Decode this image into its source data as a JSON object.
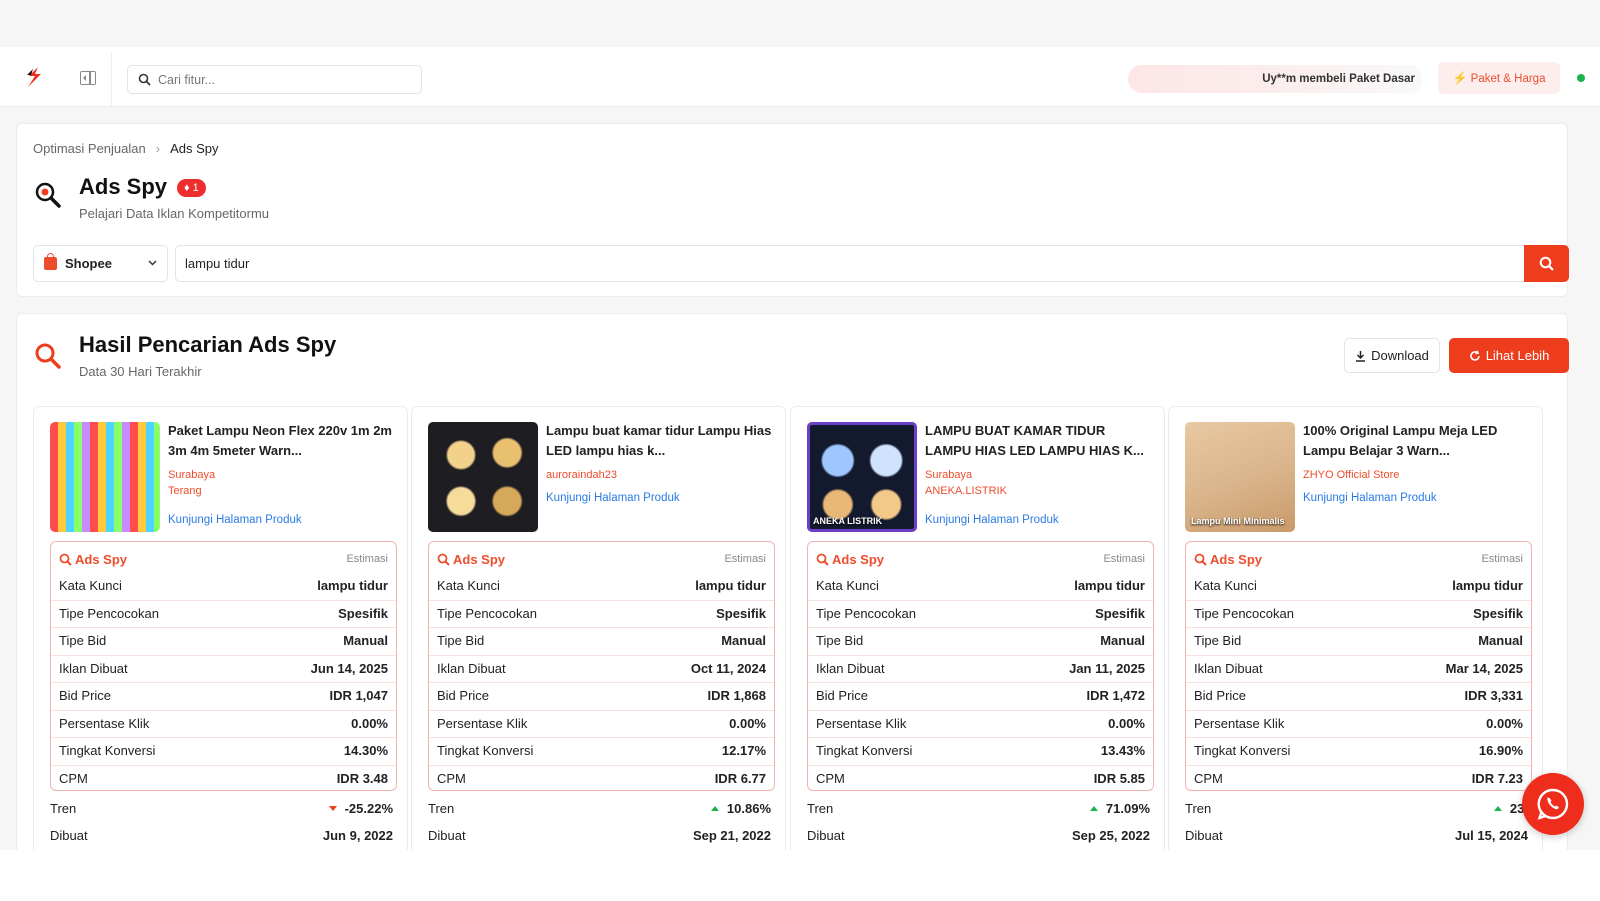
{
  "topbar": {
    "search_placeholder": "Cari fitur...",
    "notification": "Uy**m membeli Paket Dasar",
    "plan_button": "Paket & Harga"
  },
  "breadcrumb": {
    "parent": "Optimasi Penjualan",
    "current": "Ads Spy"
  },
  "page": {
    "title": "Ads Spy",
    "badge": "1",
    "subtitle": "Pelajari Data Iklan Kompetitormu"
  },
  "search": {
    "platform": "Shopee",
    "keyword": "lampu tidur"
  },
  "results": {
    "title": "Hasil Pencarian Ads Spy",
    "subtitle": "Data 30 Hari Terakhir",
    "download_label": "Download",
    "more_label": "Lihat Lebih"
  },
  "labels": {
    "ads_spy": "Ads Spy",
    "estimasi": "Estimasi",
    "visit": "Kunjungi Halaman Produk",
    "kata_kunci": "Kata Kunci",
    "tipe_pencocokan": "Tipe Pencocokan",
    "tipe_bid": "Tipe Bid",
    "iklan_dibuat": "Iklan Dibuat",
    "bid_price": "Bid Price",
    "persentase_klik": "Persentase Klik",
    "tingkat_konversi": "Tingkat Konversi",
    "cpm": "CPM",
    "tren": "Tren",
    "dibuat": "Dibuat"
  },
  "products": [
    {
      "name": "Paket Lampu Neon Flex 220v 1m 2m 3m 4m 5meter Warn...",
      "shop": "Surabaya",
      "shop2": "Terang",
      "keyword": "lampu tidur",
      "match": "Spesifik",
      "bid_type": "Manual",
      "ad_created": "Jun 14, 2025",
      "bid_price": "IDR 1,047",
      "ctr": "0.00%",
      "conversion": "14.30%",
      "cpm": "IDR 3.48",
      "trend": "-25.22%",
      "trend_dir": "down",
      "created": "Jun 9, 2022"
    },
    {
      "name": "Lampu buat kamar tidur Lampu Hias LED lampu hias k...",
      "shop": "auroraindah23",
      "shop2": "",
      "keyword": "lampu tidur",
      "match": "Spesifik",
      "bid_type": "Manual",
      "ad_created": "Oct 11, 2024",
      "bid_price": "IDR 1,868",
      "ctr": "0.00%",
      "conversion": "12.17%",
      "cpm": "IDR 6.77",
      "trend": "10.86%",
      "trend_dir": "up",
      "created": "Sep 21, 2022"
    },
    {
      "name": "LAMPU BUAT KAMAR TIDUR LAMPU HIAS LED LAMPU HIAS K...",
      "shop": "Surabaya",
      "shop2": "ANEKA.LISTRIK",
      "thumb_text": "ANEKA LISTRIK",
      "keyword": "lampu tidur",
      "match": "Spesifik",
      "bid_type": "Manual",
      "ad_created": "Jan 11, 2025",
      "bid_price": "IDR 1,472",
      "ctr": "0.00%",
      "conversion": "13.43%",
      "cpm": "IDR 5.85",
      "trend": "71.09%",
      "trend_dir": "up",
      "created": "Sep 25, 2022"
    },
    {
      "name": "100% Original Lampu Meja LED Lampu Belajar 3 Warn...",
      "shop": "ZHYO Official Store",
      "shop2": "",
      "thumb_text": "Lampu Mini Minimalis",
      "keyword": "lampu tidur",
      "match": "Spesifik",
      "bid_type": "Manual",
      "ad_created": "Mar 14, 2025",
      "bid_price": "IDR 3,331",
      "ctr": "0.00%",
      "conversion": "16.90%",
      "cpm": "IDR 7.23",
      "trend": "23.",
      "trend_dir": "up",
      "created": "Jul 15, 2024"
    }
  ],
  "colors": {
    "brand": "#ee4d2d",
    "link": "#2a7be4",
    "up": "#1bb34a",
    "down": "#ee3d1d"
  }
}
